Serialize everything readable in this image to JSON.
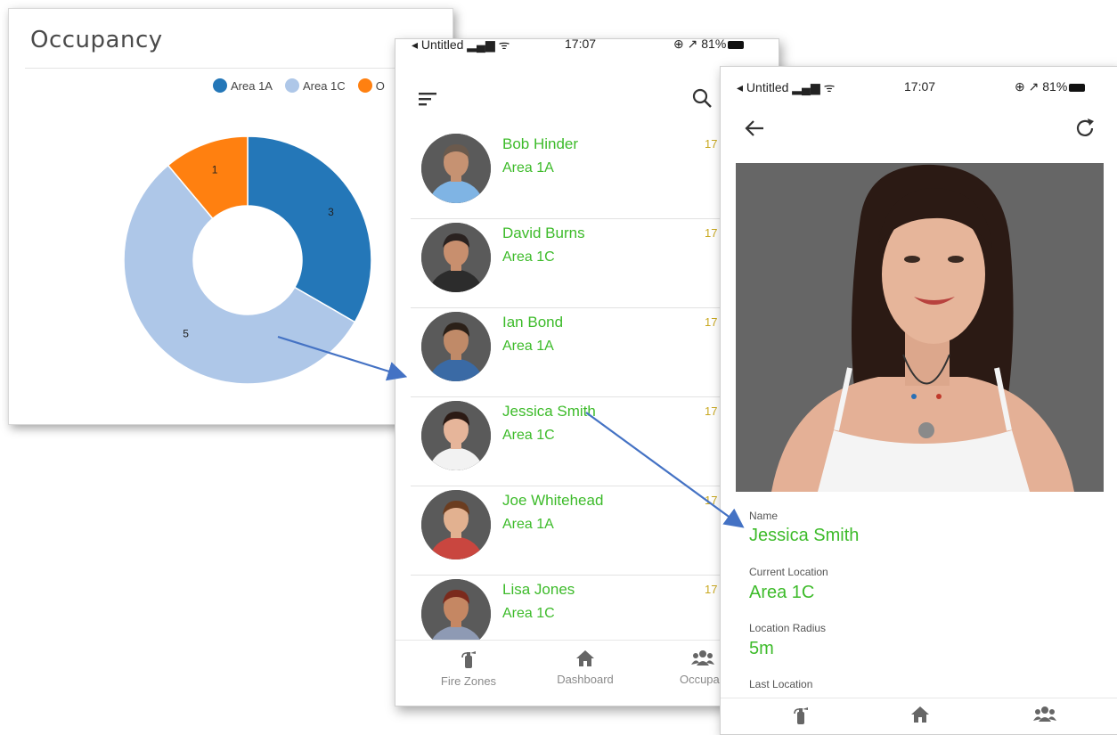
{
  "occupancy": {
    "title": "Occupancy",
    "legend": [
      {
        "label": "Area 1A",
        "color": "#2477b8"
      },
      {
        "label": "Area 1C",
        "color": "#aec7e8"
      },
      {
        "label": "O",
        "color": "#ff8010"
      }
    ]
  },
  "chart_data": {
    "type": "pie",
    "title": "Occupancy",
    "donut": true,
    "series": [
      {
        "label": "Area 1A",
        "value": 3,
        "color": "#2477b8"
      },
      {
        "label": "Area 1C",
        "value": 5,
        "color": "#aec7e8"
      },
      {
        "label": "O",
        "value": 1,
        "color": "#ff8010"
      }
    ],
    "legend_position": "top-right"
  },
  "list_screen": {
    "status": {
      "carrier": "◂ Untitled ▂▄▆ ᯤ",
      "time": "17:07",
      "battery": "⊕ ↗ 81%"
    },
    "menu_icon": "menu-icon",
    "search_icon": "search-icon",
    "people": [
      {
        "name": "Bob Hinder",
        "area": "Area 1A",
        "time": "17",
        "skin": "#c69272",
        "hair": "#6b5a4d",
        "shirt": "#7fb4e4"
      },
      {
        "name": "David Burns",
        "area": "Area 1C",
        "time": "17",
        "skin": "#c88f6e",
        "hair": "#2a2220",
        "shirt": "#2c2c2c"
      },
      {
        "name": "Ian Bond",
        "area": "Area 1A",
        "time": "17",
        "skin": "#c08a68",
        "hair": "#2b2018",
        "shirt": "#3a6aa5"
      },
      {
        "name": "Jessica Smith",
        "area": "Area 1C",
        "time": "17",
        "skin": "#e6b59a",
        "hair": "#2b1a14",
        "shirt": "#f2f2f2"
      },
      {
        "name": "Joe Whitehead",
        "area": "Area 1A",
        "time": "17",
        "skin": "#e2b190",
        "hair": "#6b3d20",
        "shirt": "#c9463f"
      },
      {
        "name": "Lisa Jones",
        "area": "Area 1C",
        "time": "17",
        "skin": "#c58763",
        "hair": "#7b2a1c",
        "shirt": "#8e9ab4"
      }
    ],
    "nav": [
      {
        "label": "Fire Zones",
        "icon": "fire-extinguisher-icon",
        "glyph": "🧯"
      },
      {
        "label": "Dashboard",
        "icon": "home-icon",
        "glyph": "🏠"
      },
      {
        "label": "Occupan",
        "icon": "people-icon",
        "glyph": "👥"
      }
    ]
  },
  "detail_screen": {
    "status": {
      "carrier": "◂ Untitled ▂▄▆ ᯤ",
      "time": "17:07",
      "battery": "⊕ ↗ 81%"
    },
    "back_icon": "back-arrow-icon",
    "refresh_icon": "refresh-icon",
    "fields": [
      {
        "label": "Name",
        "value": "Jessica Smith"
      },
      {
        "label": "Current Location",
        "value": "Area 1C"
      },
      {
        "label": "Location Radius",
        "value": "5m"
      },
      {
        "label": "Last Location",
        "value": ""
      }
    ],
    "nav": [
      {
        "icon": "fire-extinguisher-icon",
        "glyph": "🧯"
      },
      {
        "icon": "home-icon",
        "glyph": "🏠"
      },
      {
        "icon": "people-icon",
        "glyph": "👥"
      }
    ]
  }
}
